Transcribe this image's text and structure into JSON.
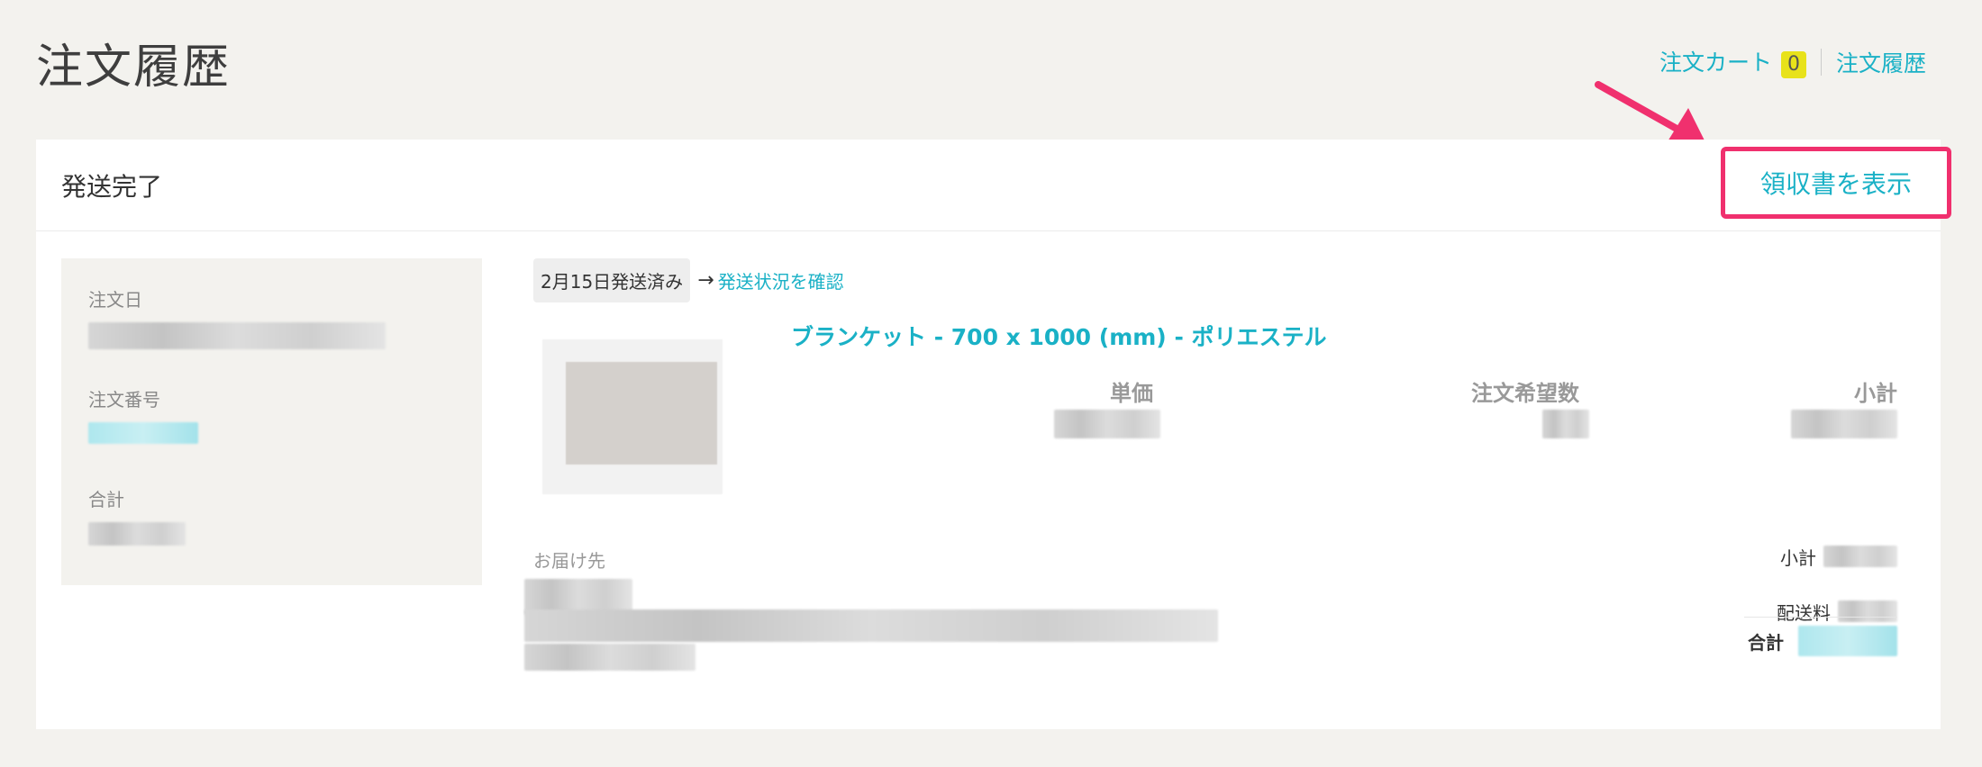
{
  "page_title": "注文履歴",
  "top_nav": {
    "cart_label": "注文カート",
    "cart_count": "0",
    "history_label": "注文履歴"
  },
  "order": {
    "status": "発送完了",
    "receipt_button": "領収書を表示",
    "side": {
      "order_date_label": "注文日",
      "order_number_label": "注文番号",
      "total_label": "合計"
    },
    "shipment": {
      "badge": "2月15日発送済み",
      "arrow": "→",
      "check_link": "発送状況を確認"
    },
    "item": {
      "name": "ブランケット - 700 x 1000 (mm) - ポリエステル",
      "unit_price_label": "単価",
      "qty_label": "注文希望数",
      "subtotal_label": "小計"
    },
    "delivery_label": "お届け先",
    "summary": {
      "subtotal_label": "小計",
      "shipping_label": "配送料",
      "total_label": "合計"
    }
  },
  "colors": {
    "accent": "#1ab1c6",
    "highlight": "#f0306e",
    "cart_badge": "#e8e21a",
    "background": "#f3f2ee"
  }
}
